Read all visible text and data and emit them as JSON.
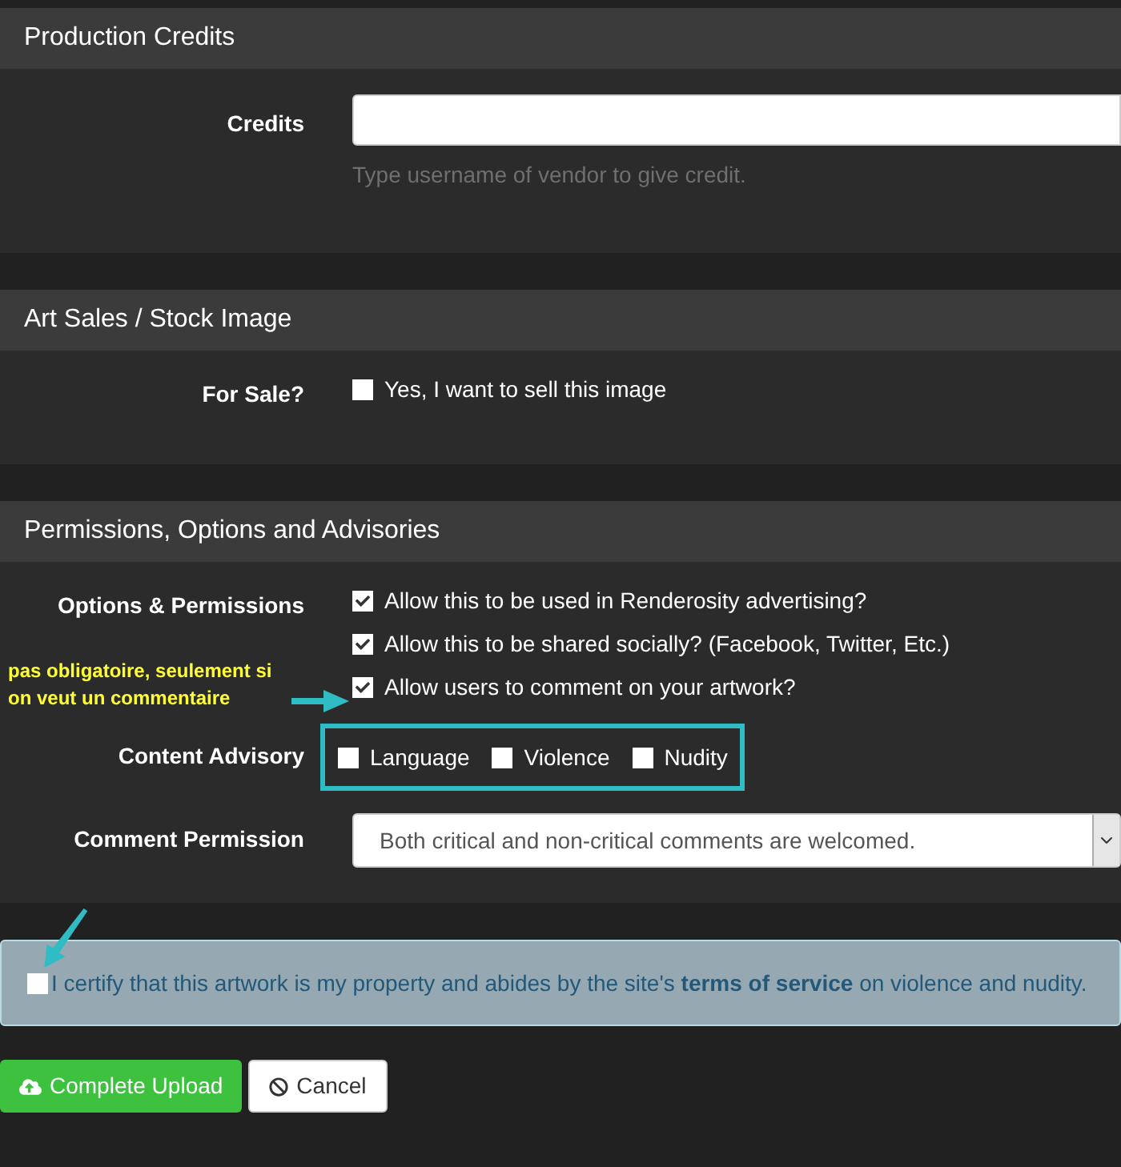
{
  "sections": [
    {
      "title": "Production Credits",
      "rows": [
        {
          "kind": "text",
          "label": "Credits",
          "value": "",
          "hint": "Type username of vendor to give credit."
        }
      ]
    },
    {
      "title": "Art Sales / Stock Image",
      "rows": [
        {
          "kind": "checks",
          "label": "For Sale?",
          "options": [
            {
              "label": "Yes, I want to sell this image",
              "checked": false
            }
          ]
        }
      ]
    },
    {
      "title": "Permissions, Options and Advisories",
      "rows": [
        {
          "kind": "checks",
          "label": "Options & Permissions",
          "options": [
            {
              "label": "Allow this to be used in Renderosity advertising?",
              "checked": true
            },
            {
              "label": "Allow this to be shared socially? (Facebook, Twitter, Etc.)",
              "checked": true
            },
            {
              "label": "Allow users to comment on your artwork?",
              "checked": true
            }
          ]
        },
        {
          "kind": "inline",
          "label": "Content Advisory",
          "highlighted": true,
          "options": [
            {
              "label": "Language",
              "checked": false
            },
            {
              "label": "Violence",
              "checked": false
            },
            {
              "label": "Nudity",
              "checked": false
            }
          ]
        },
        {
          "kind": "select",
          "label": "Comment Permission",
          "value": "Both critical and non-critical comments are welcomed."
        }
      ]
    }
  ],
  "annotation": {
    "text": "pas obligatoire, seulement si on veut un commentaire"
  },
  "certify": {
    "checked": false,
    "text": "I certify that this artwork is my property and abides by the site's",
    "link": "terms of service",
    "after": "on violence and nudity."
  },
  "buttons": [
    {
      "kind": "primary",
      "label": "Complete Upload"
    },
    {
      "kind": "default",
      "label": "Cancel"
    }
  ]
}
